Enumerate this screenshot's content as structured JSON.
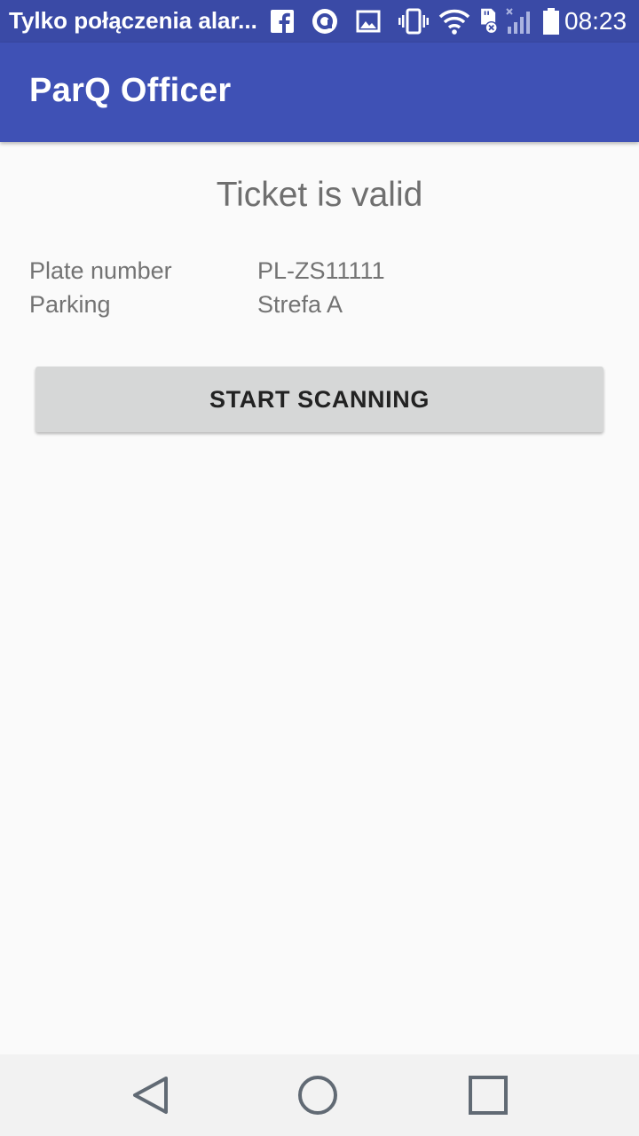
{
  "status_bar": {
    "notification_text": "Tylko połączenia alar...",
    "time": "08:23",
    "icons": [
      "facebook-icon",
      "messenger-icon",
      "image-icon",
      "vibrate-icon",
      "wifi-icon",
      "sd-card-icon",
      "signal-icon",
      "battery-icon"
    ]
  },
  "app_bar": {
    "title": "ParQ Officer",
    "color": "#3f51b5"
  },
  "main": {
    "heading": "Ticket is valid",
    "details": [
      {
        "label": "Plate number",
        "value": "PL-ZS11111"
      },
      {
        "label": "Parking",
        "value": "Strefa A"
      }
    ],
    "scan_button_label": "START SCANNING"
  },
  "nav_bar": {
    "icons": [
      "back-icon",
      "home-icon",
      "recents-icon"
    ]
  }
}
